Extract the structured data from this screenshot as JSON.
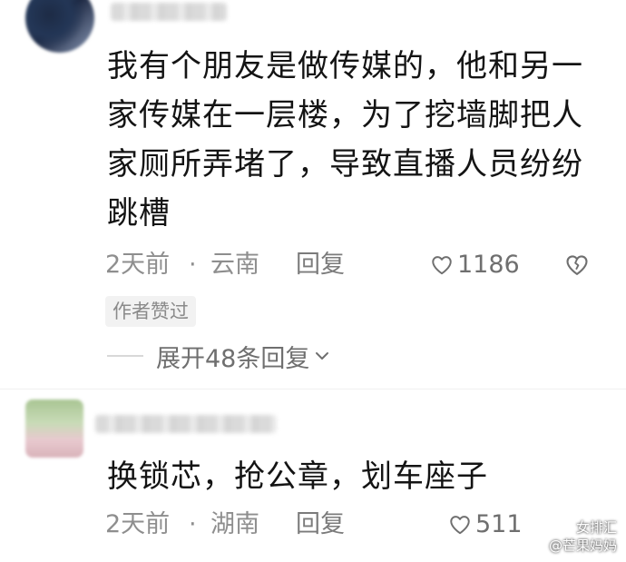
{
  "comments": [
    {
      "text": "我有个朋友是做传媒的，他和另一家传媒在一层楼，为了挖墙脚把人家厕所弄堵了，导致直播人员纷纷跳槽",
      "time": "2天前",
      "separator": "·",
      "location": "云南",
      "reply_label": "回复",
      "likes": "1186",
      "author_badge": "作者赞过",
      "expand_label": "展开48条回复"
    },
    {
      "text": "换锁芯，抢公章，划车座子",
      "time": "2天前",
      "separator": "·",
      "location": "湖南",
      "reply_label": "回复",
      "likes": "511"
    }
  ],
  "watermark": {
    "line1": "女排汇",
    "line2": "@芒果妈妈"
  },
  "icons": {
    "like": "heart-outline-icon",
    "dislike": "broken-heart-icon",
    "expand": "chevron-down-icon",
    "watermark": "weibo-icon"
  },
  "colors": {
    "text_primary": "#141414",
    "text_meta": "#8e8e8e",
    "badge_bg": "#f2f2f2"
  }
}
